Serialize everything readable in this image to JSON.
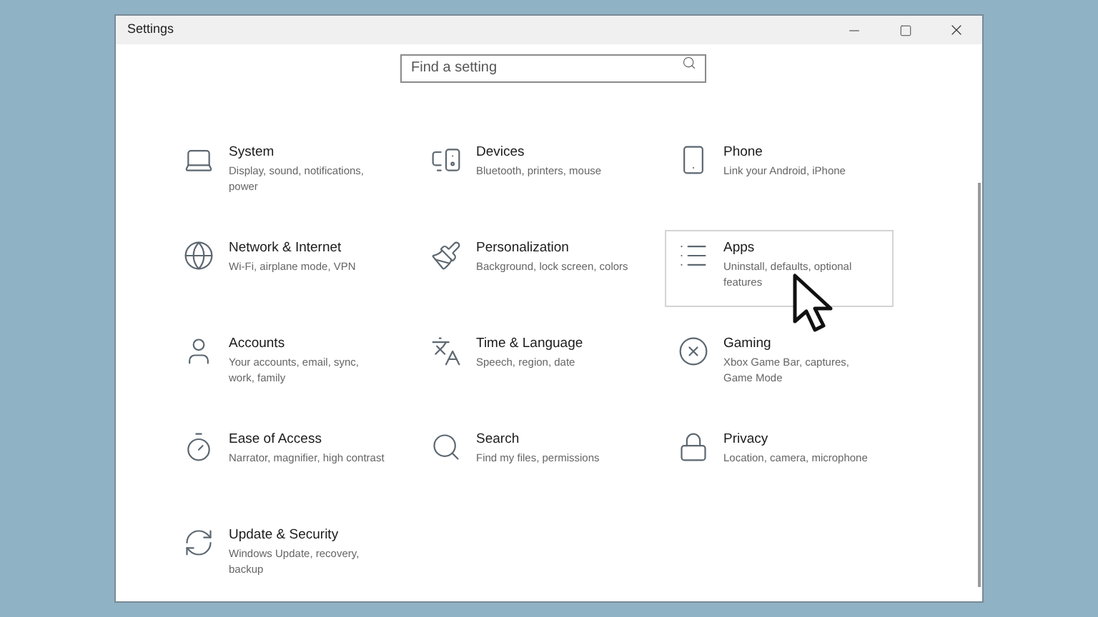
{
  "window": {
    "title": "Settings"
  },
  "search": {
    "placeholder": "Find a setting"
  },
  "categories": [
    {
      "title": "System",
      "description": "Display, sound, notifications, power",
      "hovered": false
    },
    {
      "title": "Devices",
      "description": "Bluetooth, printers, mouse",
      "hovered": false
    },
    {
      "title": "Phone",
      "description": "Link your Android, iPhone",
      "hovered": false
    },
    {
      "title": "Network & Internet",
      "description": "Wi-Fi, airplane mode, VPN",
      "hovered": false
    },
    {
      "title": "Personalization",
      "description": "Background, lock screen, colors",
      "hovered": false
    },
    {
      "title": "Apps",
      "description": "Uninstall, defaults, optional features",
      "hovered": true
    },
    {
      "title": "Accounts",
      "description": "Your accounts, email, sync, work, family",
      "hovered": false
    },
    {
      "title": "Time & Language",
      "description": "Speech, region, date",
      "hovered": false
    },
    {
      "title": "Gaming",
      "description": "Xbox Game Bar, captures, Game Mode",
      "hovered": false
    },
    {
      "title": "Ease of Access",
      "description": "Narrator, magnifier, high contrast",
      "hovered": false
    },
    {
      "title": "Search",
      "description": "Find my files, permissions",
      "hovered": false
    },
    {
      "title": "Privacy",
      "description": "Location, camera, microphone",
      "hovered": false
    },
    {
      "title": "Update & Security",
      "description": "Windows Update, recovery, backup",
      "hovered": false
    }
  ]
}
